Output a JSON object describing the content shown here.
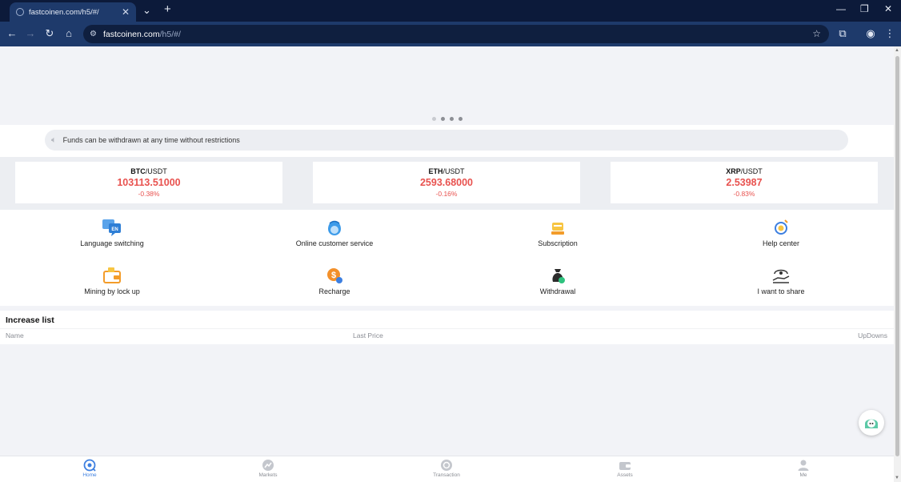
{
  "browser": {
    "tab_title": "fastcoinen.com/h5/#/",
    "url_host": "fastcoinen.com",
    "url_path": "/h5/#/"
  },
  "notice": {
    "text": "Funds can be withdrawn at any time without restrictions"
  },
  "banner": {
    "slide_count": 4,
    "active_slide": 2
  },
  "tickers": [
    {
      "base": "BTC",
      "quote": "/USDT",
      "price": "103113.51000",
      "change": "-0.38%"
    },
    {
      "base": "ETH",
      "quote": "/USDT",
      "price": "2593.68000",
      "change": "-0.16%"
    },
    {
      "base": "XRP",
      "quote": "/USDT",
      "price": "2.53987",
      "change": "-0.83%"
    }
  ],
  "menu": [
    {
      "label": "Language switching",
      "icon": "language-icon"
    },
    {
      "label": "Online customer service",
      "icon": "customer-service-icon"
    },
    {
      "label": "Subscription",
      "icon": "subscription-icon"
    },
    {
      "label": "Help center",
      "icon": "help-center-icon"
    },
    {
      "label": "Mining by lock up",
      "icon": "mining-wallet-icon"
    },
    {
      "label": "Recharge",
      "icon": "recharge-coin-icon"
    },
    {
      "label": "Withdrawal",
      "icon": "withdrawal-bag-icon"
    },
    {
      "label": "I want to share",
      "icon": "share-hand-icon"
    }
  ],
  "increase_list": {
    "title": "Increase list",
    "columns": [
      "Name",
      "Last Price",
      "UpDowns"
    ]
  },
  "bottom_nav": [
    {
      "label": "Home",
      "icon": "home-icon",
      "active": true
    },
    {
      "label": "Markets",
      "icon": "markets-icon",
      "active": false
    },
    {
      "label": "Transaction",
      "icon": "transaction-icon",
      "active": false
    },
    {
      "label": "Assets",
      "icon": "assets-wallet-icon",
      "active": false
    },
    {
      "label": "Me",
      "icon": "user-icon",
      "active": false
    }
  ],
  "colors": {
    "up_down_red": "#e8524f",
    "accent_blue": "#3d7fe0",
    "browser_dark": "#0c1a3a",
    "browser_toolbar": "#1e3a6b"
  }
}
